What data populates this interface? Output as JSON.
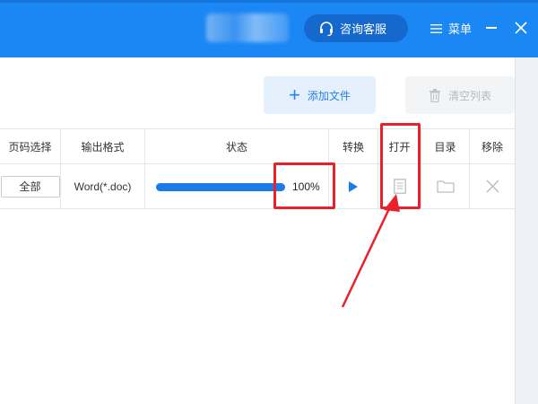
{
  "header": {
    "service_label": "咨询客服",
    "menu_label": "菜单",
    "accent": "#1a87f5"
  },
  "toolbar": {
    "add_file_label": "添加文件",
    "clear_list_label": "清空列表"
  },
  "table": {
    "columns": [
      "页码选择",
      "输出格式",
      "状态",
      "转换",
      "打开",
      "目录",
      "移除"
    ],
    "rows": [
      {
        "page_selection": "全部",
        "output_format": "Word(*.doc)",
        "progress_value": 1.0,
        "progress_text": "100%",
        "convert_icon": "play-icon",
        "open_icon": "document-icon",
        "folder_icon": "folder-icon",
        "remove_icon": "close-icon"
      }
    ]
  },
  "annotation": {
    "highlight_color": "#e8212a"
  }
}
